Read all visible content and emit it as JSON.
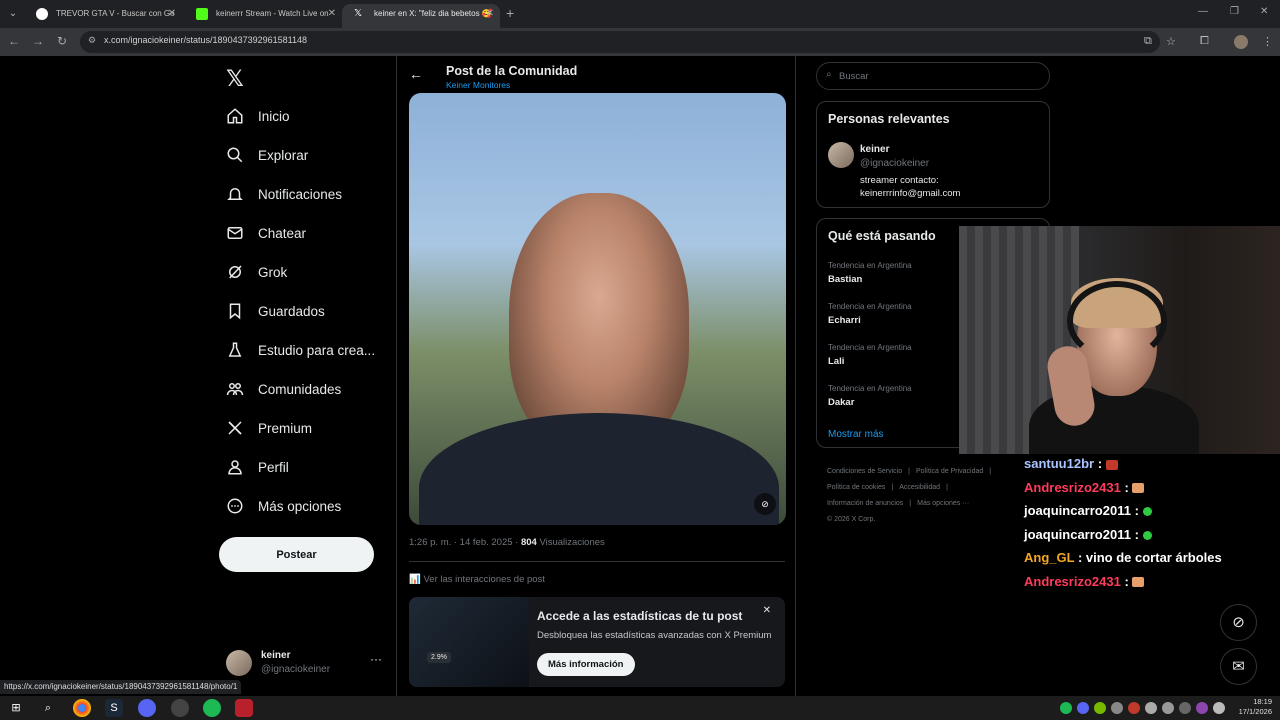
{
  "browser": {
    "tabs": [
      {
        "title": "TREVOR GTA V - Buscar con Go",
        "active": false
      },
      {
        "title": "keinerrr Stream - Watch Live on",
        "active": false
      },
      {
        "title": "keiner en X: \"feliz dia bebetos 🥰",
        "active": true
      }
    ],
    "url": "x.com/ignaciokeiner/status/1890437392961581148",
    "status_url": "https://x.com/ignaciokeiner/status/1890437392961581148/photo/1"
  },
  "sidebar": {
    "items": [
      {
        "label": "Inicio",
        "icon": "home-icon"
      },
      {
        "label": "Explorar",
        "icon": "search-icon"
      },
      {
        "label": "Notificaciones",
        "icon": "bell-icon"
      },
      {
        "label": "Chatear",
        "icon": "mail-icon"
      },
      {
        "label": "Grok",
        "icon": "grok-icon"
      },
      {
        "label": "Guardados",
        "icon": "bookmark-icon"
      },
      {
        "label": "Estudio para crea...",
        "icon": "flask-icon"
      },
      {
        "label": "Comunidades",
        "icon": "communities-icon"
      },
      {
        "label": "Premium",
        "icon": "x-icon"
      },
      {
        "label": "Perfil",
        "icon": "person-icon"
      },
      {
        "label": "Más opciones",
        "icon": "more-circle-icon"
      }
    ],
    "post_button": "Postear",
    "account": {
      "name": "keiner",
      "handle": "@ignaciokeiner"
    }
  },
  "post": {
    "header_title": "Post de la Comunidad",
    "header_sub": "Keiner Monitores",
    "meta_time": "1:26 p. m. · 14 feb. 2025 · ",
    "views_count": "804",
    "views_label": " Visualizaciones",
    "interactions": "Ver las interacciones de post",
    "promo": {
      "title": "Accede a las estadísticas de tu post",
      "desc": "Desbloquea las estadísticas avanzadas con X Premium",
      "cta": "Más información",
      "chip": "2.9%"
    }
  },
  "right": {
    "search_placeholder": "Buscar",
    "relevant_title": "Personas relevantes",
    "person": {
      "name": "keiner",
      "handle": "@ignaciokeiner",
      "bio": "streamer contacto: keinerrrinfo@gmail.com"
    },
    "trending_title": "Qué está pasando",
    "trends": [
      {
        "context": "Tendencia en Argentina",
        "topic": "Bastian"
      },
      {
        "context": "Tendencia en Argentina",
        "topic": "Echarri"
      },
      {
        "context": "Tendencia en Argentina",
        "topic": "Lali"
      },
      {
        "context": "Tendencia en Argentina",
        "topic": "Dakar"
      }
    ],
    "show_more": "Mostrar más",
    "footer": [
      "Condiciones de Servicio",
      "|",
      "Política de Privacidad",
      "|",
      "Política de cookies",
      "|",
      "Accesibilidad",
      "|",
      "Información de anuncios",
      "|",
      "Más opciones ···",
      "© 2026 X Corp."
    ]
  },
  "chat": [
    {
      "user": "santuu12br",
      "color": "#a9c4ff",
      "msg": ""
    },
    {
      "user": "Andresrizo2431",
      "color": "#ff3b5c",
      "msg": ""
    },
    {
      "user": "joaquincarro2011",
      "color": "#ffffff",
      "msg": ""
    },
    {
      "user": "joaquincarro2011",
      "color": "#ffffff",
      "msg": ""
    },
    {
      "user": "Ang_GL",
      "color": "#f5a623",
      "msg": " vino de cortar árboles"
    },
    {
      "user": "Andresrizo2431",
      "color": "#ff3b5c",
      "msg": ""
    }
  ],
  "taskbar": {
    "time": "18:19",
    "date": "17/1/2026"
  }
}
